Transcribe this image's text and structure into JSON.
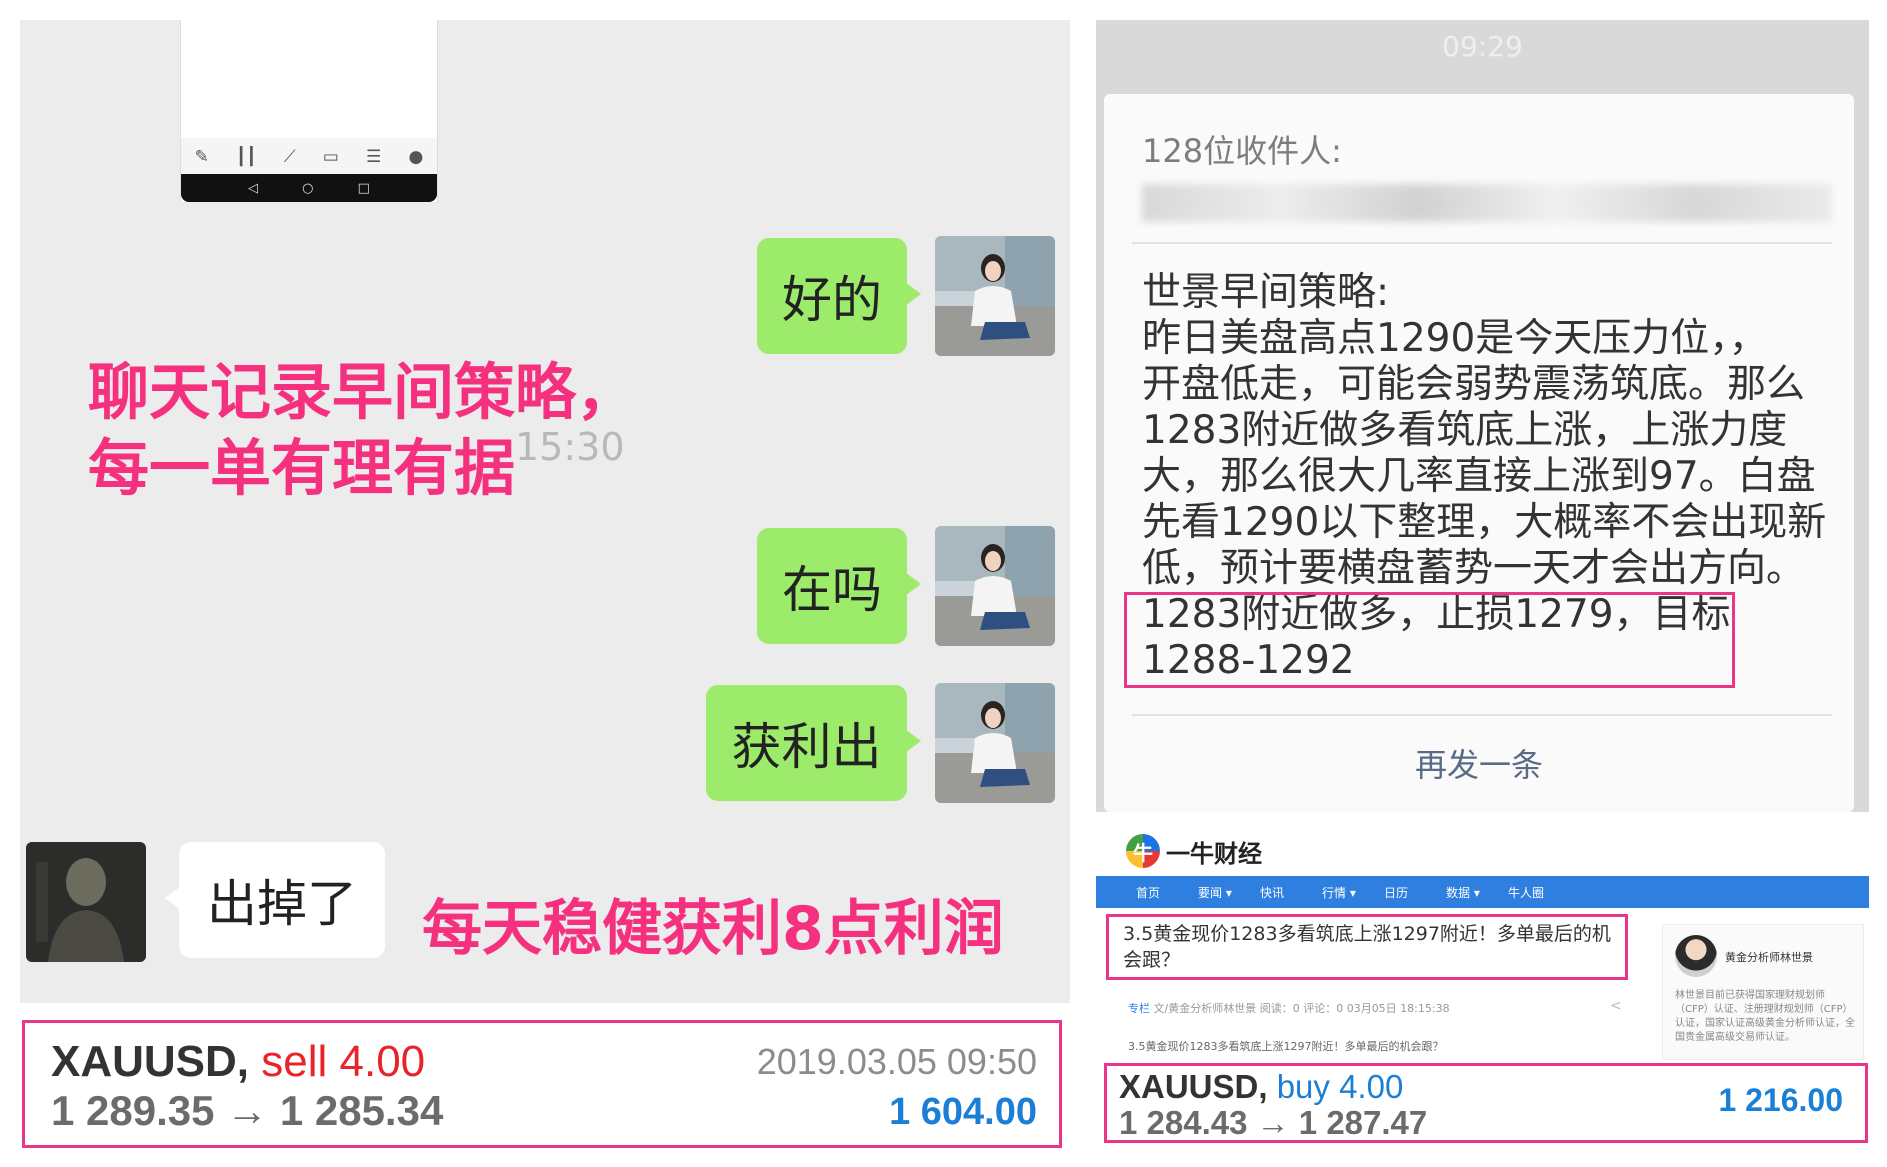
{
  "chat": {
    "timestamp": "15:30",
    "overlay_line1": "聊天记录早间策略，",
    "overlay_line2": "每一单有理有据",
    "overlay_bottom": "每天稳健获利8点利润",
    "messages": [
      {
        "text": "好的",
        "side": "right"
      },
      {
        "text": "在吗",
        "side": "right"
      },
      {
        "text": "获利出",
        "side": "right"
      },
      {
        "text": "出掉了",
        "side": "left"
      }
    ]
  },
  "phone_toolbar_icons": [
    "draw-icon",
    "candlestick-icon",
    "chart-line-icon",
    "inbox-icon",
    "news-icon",
    "chat-icon"
  ],
  "phone_navbar_icons": [
    "back-icon",
    "home-icon",
    "recent-apps-icon"
  ],
  "trade_left": {
    "symbol": "XAUUSD,",
    "side": "sell 4.00",
    "prices": "1 289.35 → 1 285.34",
    "date": "2019.03.05 09:50",
    "profit": "1 604.00"
  },
  "sms": {
    "time": "09:29",
    "recipients_label": "128位收件人:",
    "body": [
      "世景早间策略:",
      "昨日美盘高点1290是今天压力位，，",
      "开盘低走，可能会弱势震荡筑底。那么",
      "1283附近做多看筑底上涨，上涨力度",
      "大，那么很大几率直接上涨到97。白盘",
      "先看1290以下整理，大概率不会出现新",
      "低，预计要横盘蓄势一天才会出方向。",
      "1283附近做多，止损1279，目标",
      "1288-1292"
    ],
    "resend": "再发一条"
  },
  "news": {
    "logo_text": "一牛财经",
    "nav": [
      "首页",
      "要闻 ▾",
      "快讯",
      "行情 ▾",
      "日历",
      "数据 ▾",
      "牛人圈"
    ],
    "title": "3.5黄金现价1283多看筑底上涨1297附近！多单最后的机会跟？",
    "meta_tag": "专栏",
    "meta": "文/黄金分析师林世景    阅读：0    评论：0    03月05日 18:15:38",
    "snippet": "3.5黄金现价1283多看筑底上涨1297附近！多单最后的机会跟？",
    "author_name": "黄金分析师林世景",
    "author_desc": "林世景目前已获得国家理财规划师（CFP）认证、注册理财规划师（CFP）认证，国家认证高级黄金分析师认证，全国贵金属高级交易师认证。"
  },
  "trade_right": {
    "symbol": "XAUUSD,",
    "side": "buy 4.00",
    "prices": "1 284.43 → 1 287.47",
    "profit": "1 216.00"
  },
  "colors": {
    "accent_pink": "#e8368a",
    "overlay_pink": "#f5317f",
    "bubble_green": "#9ceb6a",
    "sell_red": "#e8232a",
    "buy_blue": "#1b7fd6"
  }
}
